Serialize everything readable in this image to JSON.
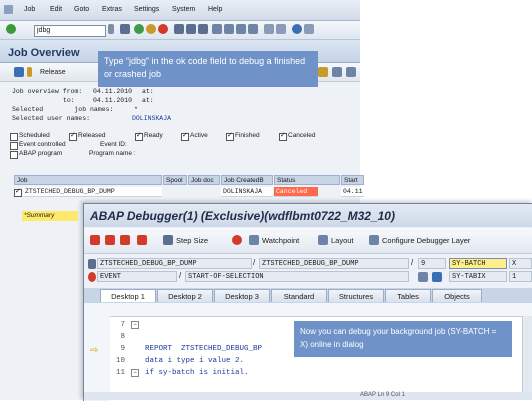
{
  "menu": {
    "items": [
      "Job",
      "Edit",
      "Goto",
      "Extras",
      "Settings",
      "System",
      "Help"
    ]
  },
  "toolbar": {
    "okcode_value": "jdbg"
  },
  "job_overview": {
    "title": "Job Overview",
    "release_label": "Release",
    "callout": "Type “jdbg” in the ok code field to debug a finished or crashed job",
    "criteria": {
      "from_label": "Job overview from:",
      "from_date": "04.11.2010",
      "from_at": "at:",
      "to_label": "to:",
      "to_date": "04.11.2010",
      "to_at": "at:",
      "selected_job_label": "Selected        job names:",
      "selected_job_value": "*",
      "selected_user_label": "Selected user names:",
      "selected_user_value": "DOLINSKAJA"
    },
    "status_filters": [
      {
        "label": "Scheduled",
        "checked": false
      },
      {
        "label": "Released",
        "checked": true
      },
      {
        "label": "Ready",
        "checked": true
      },
      {
        "label": "Active",
        "checked": true
      },
      {
        "label": "Finished",
        "checked": true
      },
      {
        "label": "Canceled",
        "checked": true
      }
    ],
    "event_controlled_label": "Event controlled",
    "event_id_label": "Event ID:",
    "abap_program_label": "ABAP program",
    "program_name_label": "Program name :",
    "table": {
      "columns": [
        "Job",
        "Spool",
        "Job doc",
        "Job CreatedB",
        "Status",
        "Start"
      ],
      "row": {
        "job": "ZTSTECHED_DEBUG_BP_DUMP",
        "spool": "",
        "job_doc": "",
        "created_by": "DOLINSKAJA",
        "status": "Canceled",
        "start": "04.11"
      },
      "summary_label": "*Summary"
    }
  },
  "debugger": {
    "title": "ABAP Debugger(1)  (Exclusive)(wdflbmt0722_M32_10)",
    "toolbar": {
      "step_size": "Step Size",
      "watchpoint": "Watchpoint",
      "layout": "Layout",
      "configure": "Configure Debugger Layer"
    },
    "fields": {
      "program1": "ZTSTECHED_DEBUG_BP_DUMP",
      "program2": "ZTSTECHED_DEBUG_BP_DUMP",
      "line_no": "9",
      "var1": "SY-BATCH",
      "val1": "X",
      "event_type": "EVENT",
      "event_name": "START-OF-SELECTION",
      "var2": "SY-TABIX",
      "val2": "1"
    },
    "tabs": [
      "Desktop 1",
      "Desktop 2",
      "Desktop 3",
      "Standard",
      "Structures",
      "Tables",
      "Objects"
    ],
    "code": {
      "lines": [
        {
          "num": "7",
          "text": ""
        },
        {
          "num": "8",
          "text": ""
        },
        {
          "num": "9",
          "text": "REPORT  ZTSTECHED_DEBUG_BP"
        },
        {
          "num": "10",
          "text": "data i type i value 2."
        },
        {
          "num": "11",
          "text": "if sy-batch is initial."
        }
      ]
    },
    "callout": "Now you can debug your background job (SY-BATCH = X) online in dialog",
    "status_text": "ABAP    Ln 9 Col 1"
  },
  "colors": {
    "callout": "#6f93c8",
    "canceled": "#ff6b4a",
    "highlight": "#ffef8c"
  }
}
